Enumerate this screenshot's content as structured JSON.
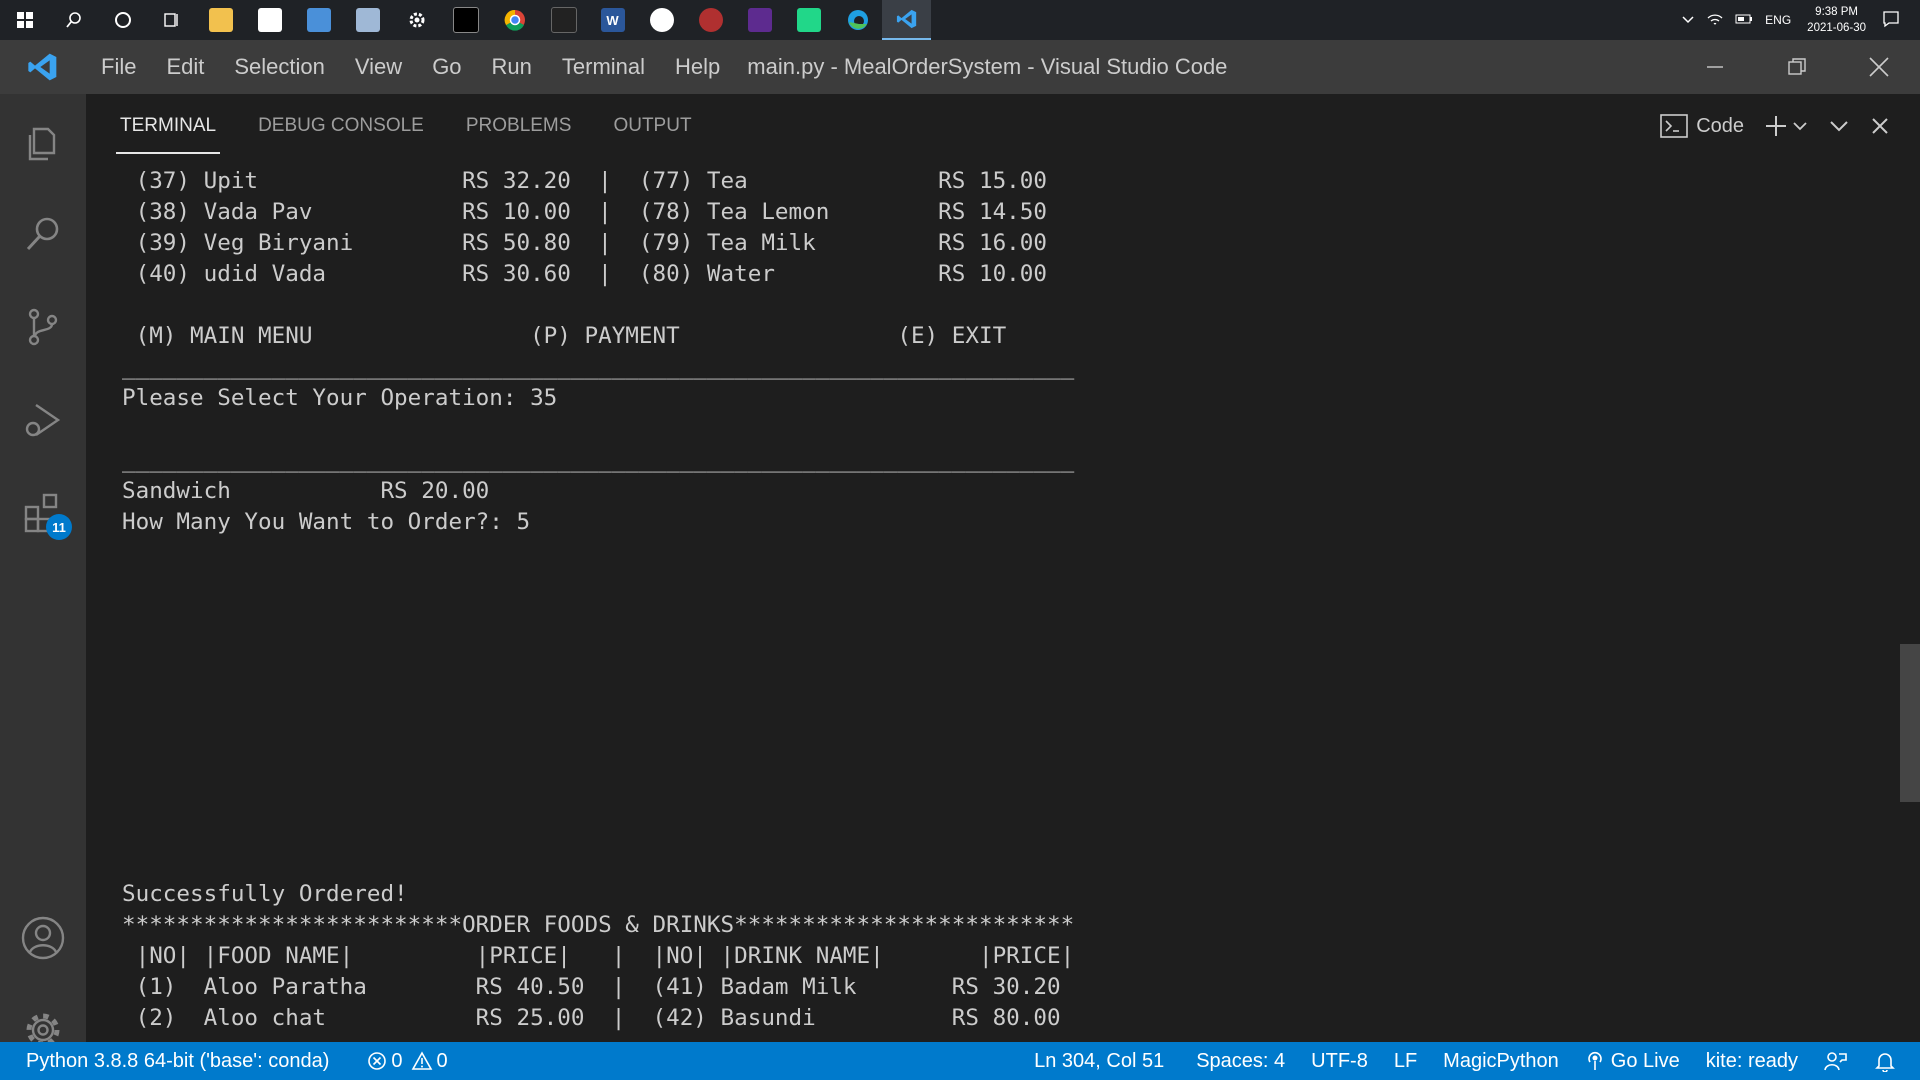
{
  "taskbar": {
    "apps": [
      {
        "icon": "windows-start-icon"
      },
      {
        "icon": "search-icon"
      },
      {
        "icon": "cortana-icon"
      },
      {
        "icon": "task-view-icon"
      },
      {
        "icon": "file-explorer-icon"
      },
      {
        "icon": "store-icon"
      },
      {
        "icon": "app-icon"
      },
      {
        "icon": "app-icon"
      },
      {
        "icon": "settings-gear-icon"
      },
      {
        "icon": "terminal-icon"
      },
      {
        "icon": "chrome-icon"
      },
      {
        "icon": "app-icon"
      },
      {
        "icon": "word-icon"
      },
      {
        "icon": "app-icon"
      },
      {
        "icon": "app-icon"
      },
      {
        "icon": "intellij-icon"
      },
      {
        "icon": "pycharm-icon"
      },
      {
        "icon": "edge-icon"
      },
      {
        "icon": "vscode-icon"
      }
    ],
    "tray": {
      "language": "ENG",
      "time": "9:38 PM",
      "date": "2021-06-30"
    }
  },
  "titlebar": {
    "menu": [
      "File",
      "Edit",
      "Selection",
      "View",
      "Go",
      "Run",
      "Terminal",
      "Help"
    ],
    "title": "main.py - MealOrderSystem - Visual Studio Code"
  },
  "activitybar": {
    "items": [
      {
        "icon": "explorer-icon"
      },
      {
        "icon": "search-icon"
      },
      {
        "icon": "source-control-icon"
      },
      {
        "icon": "run-debug-icon"
      },
      {
        "icon": "extensions-icon",
        "badge": "11"
      }
    ],
    "bottom": [
      {
        "icon": "account-icon"
      },
      {
        "icon": "manage-gear-icon"
      }
    ]
  },
  "panel": {
    "tabs": [
      "TERMINAL",
      "DEBUG CONSOLE",
      "PROBLEMS",
      "OUTPUT"
    ],
    "active_tab": "TERMINAL",
    "shell_label": "Code"
  },
  "terminal": {
    "lines": [
      " (37) Upit               RS 32.20  |  (77) Tea              RS 15.00",
      " (38) Vada Pav           RS 10.00  |  (78) Tea Lemon        RS 14.50",
      " (39) Veg Biryani        RS 50.80  |  (79) Tea Milk         RS 16.00",
      " (40) udid Vada          RS 30.60  |  (80) Water            RS 10.00",
      "",
      " (M) MAIN MENU                (P) PAYMENT                (E) EXIT",
      "______________________________________________________________________",
      "Please Select Your Operation: 35",
      "",
      "______________________________________________________________________",
      "Sandwich           RS 20.00",
      "How Many You Want to Order?: 5",
      "",
      "",
      "",
      "",
      "",
      "",
      "",
      "",
      "",
      "",
      "",
      "",
      "Successfully Ordered!",
      "*************************ORDER FOODS & DRINKS*************************",
      " |NO| |FOOD NAME|         |PRICE|   |  |NO| |DRINK NAME|       |PRICE|",
      " (1)  Aloo Paratha        RS 40.50  |  (41) Badam Milk       RS 30.20",
      " (2)  Aloo chat           RS 25.00  |  (42) Basundi          RS 80.00"
    ]
  },
  "statusbar": {
    "python": "Python 3.8.8 64-bit ('base': conda)",
    "errors": "0",
    "warnings": "0",
    "position": "Ln 304, Col 51",
    "spaces": "Spaces: 4",
    "encoding": "UTF-8",
    "eol": "LF",
    "language": "MagicPython",
    "golive": "Go Live",
    "kite": "kite: ready"
  }
}
